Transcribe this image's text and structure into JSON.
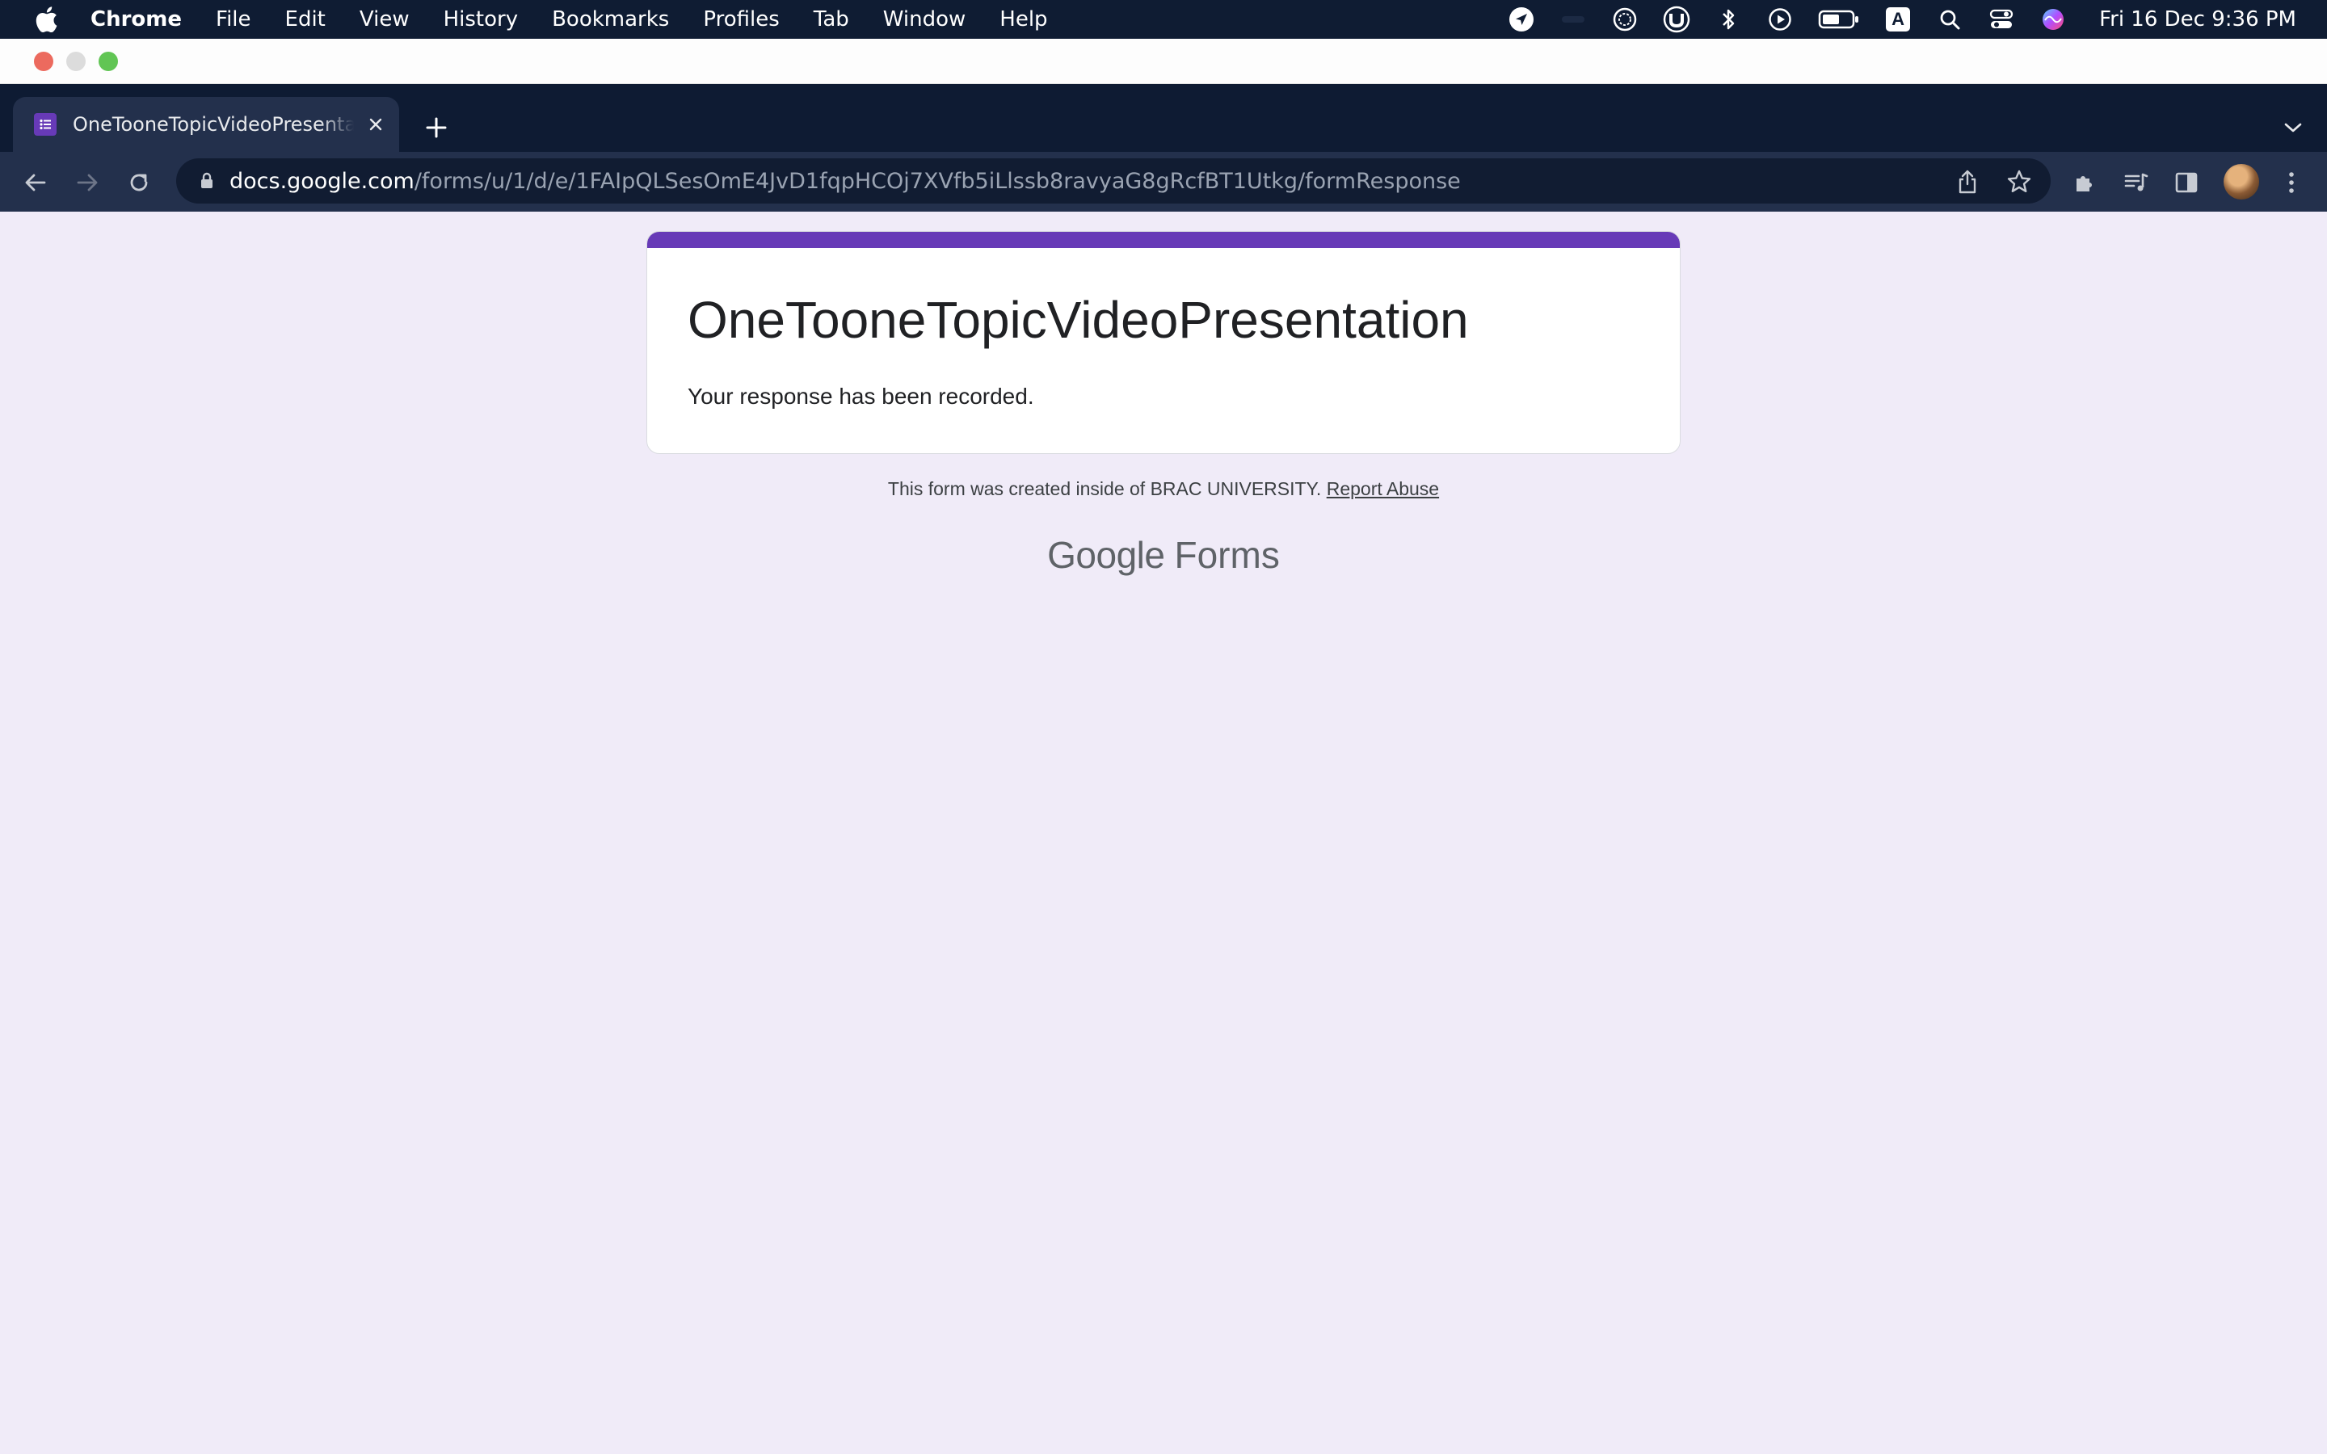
{
  "menubar": {
    "app_name": "Chrome",
    "items": [
      "File",
      "Edit",
      "View",
      "History",
      "Bookmarks",
      "Profiles",
      "Tab",
      "Window",
      "Help"
    ],
    "clock": "Fri 16 Dec  9:36 PM",
    "status_icons": [
      "location-arrow-icon",
      "hidden-icon",
      "activity-icon",
      "vpn-icon",
      "bluetooth-icon",
      "play-icon",
      "battery-icon",
      "keyboard-input-icon",
      "search-icon",
      "control-center-icon",
      "siri-icon"
    ],
    "keyboard_letter": "A"
  },
  "tab": {
    "title": "OneTooneTopicVideoPresentation",
    "favicon": "google-forms-icon"
  },
  "omnibox": {
    "host": "docs.google.com",
    "path": "/forms/u/1/d/e/1FAIpQLSesOmE4JvD1fqpHCOj7XVfb5iLlssb8ravyaG8gRcfBT1Utkg/formResponse"
  },
  "form": {
    "title": "OneTooneTopicVideoPresentation",
    "confirmation": "Your response has been recorded.",
    "footer_text": "This form was created inside of BRAC UNIVERSITY.",
    "report_link": "Report Abuse",
    "brand_google": "Google",
    "brand_forms": "Forms"
  },
  "colors": {
    "page_bg": "#f0ebf8",
    "accent": "#673ab7",
    "menubar_bg": "#0f1c33",
    "toolbar_bg": "#23304c"
  }
}
